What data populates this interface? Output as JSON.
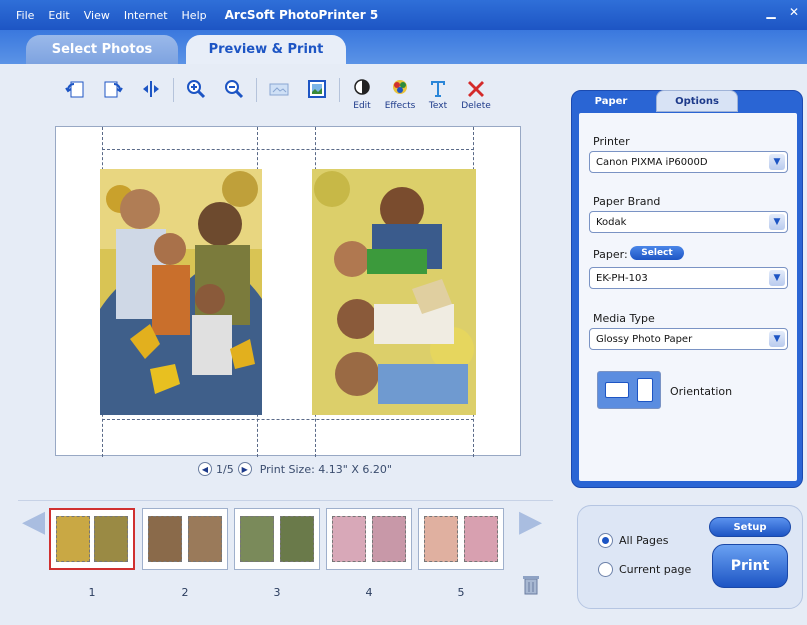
{
  "menu": [
    "File",
    "Edit",
    "View",
    "Internet",
    "Help"
  ],
  "app_title": "ArcSoft PhotoPrinter 5",
  "tabs": {
    "select": "Select Photos",
    "preview": "Preview & Print"
  },
  "toolbar": {
    "edit": "Edit",
    "effects": "Effects",
    "text": "Text",
    "delete": "Delete"
  },
  "pagenav": {
    "page": "1/5",
    "print_size": "Print Size: 4.13\" X 6.20\""
  },
  "panel": {
    "tab_paper": "Paper",
    "tab_options": "Options",
    "printer_label": "Printer",
    "printer_value": "Canon PIXMA iP6000D",
    "brand_label": "Paper Brand",
    "brand_value": "Kodak",
    "paper_label": "Paper:",
    "paper_select": "Select",
    "paper_value": "EK-PH-103",
    "media_label": "Media Type",
    "media_value": "Glossy Photo Paper",
    "orientation_label": "Orientation"
  },
  "thumbnails": [
    "1",
    "2",
    "3",
    "4",
    "5"
  ],
  "print": {
    "all_pages": "All Pages",
    "current_page": "Current page",
    "setup": "Setup",
    "print": "Print"
  },
  "colors": {
    "accent": "#1d55c4",
    "selected_thumb": "#d03030"
  }
}
